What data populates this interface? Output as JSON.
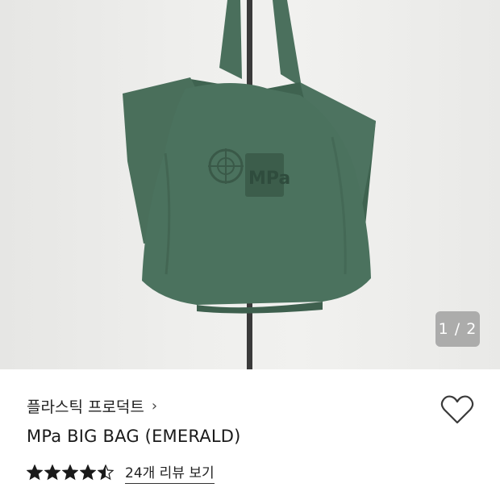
{
  "gallery": {
    "image_label": "MPa BIG BAG (EMERALD) product photo",
    "counter": "1 / 2"
  },
  "product": {
    "brand": "플라스틱 프로덕트",
    "brand_chevron": "›",
    "title": "MPa BIG BAG (EMERALD)",
    "rating": 4.5,
    "rating_max": 5,
    "review_link": "24개 리뷰 보기"
  },
  "colors": {
    "bag_green": "#466b58",
    "star": "#1a1a1a"
  }
}
